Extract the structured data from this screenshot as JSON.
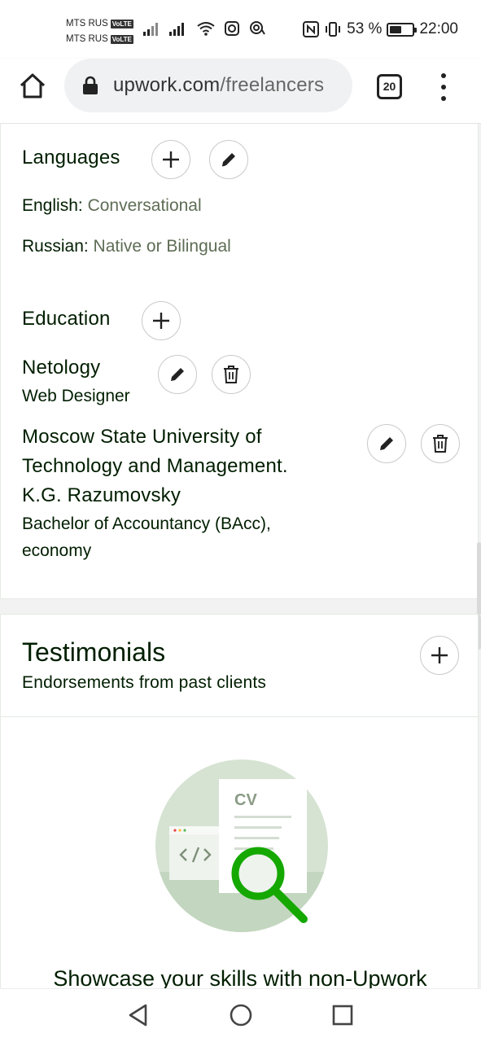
{
  "status_bar": {
    "carrier1": "MTS RUS",
    "carrier2": "MTS RUS",
    "volte": "VoLTE",
    "battery_percent": "53 %",
    "battery_level": 0.53,
    "time": "22:00"
  },
  "browser": {
    "url_host": "upwork.com",
    "url_path": "/freelancers",
    "tab_count": "20"
  },
  "languages": {
    "heading": "Languages",
    "items": [
      {
        "name": "English:",
        "level": "Conversational"
      },
      {
        "name": "Russian:",
        "level": "Native or Bilingual"
      }
    ]
  },
  "education": {
    "heading": "Education",
    "items": [
      {
        "school": "Netology",
        "degree": "Web Designer"
      },
      {
        "school_lines": [
          "Moscow State University of",
          "Technology and Management.",
          "K.G. Razumovsky"
        ],
        "degree_lines": [
          "Bachelor of Accountancy (BAcc),",
          "economy"
        ]
      }
    ]
  },
  "testimonials": {
    "heading": "Testimonials",
    "subheading": "Endorsements from past clients",
    "illustration_label": "CV",
    "cta_text": "Showcase your skills with non-Upwork"
  },
  "colors": {
    "brand_green": "#14a800",
    "text_dark": "#001e00",
    "text_muted": "#5e6d55",
    "border": "#c9c9c9"
  }
}
